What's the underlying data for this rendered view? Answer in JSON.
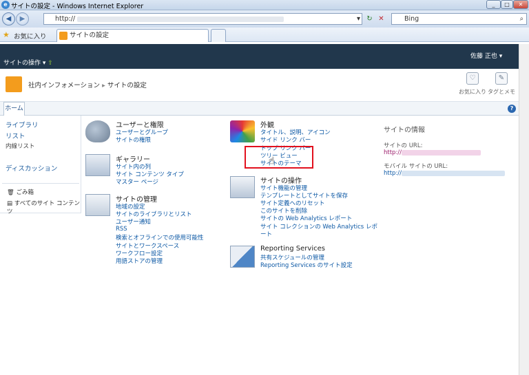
{
  "window": {
    "title": "サイトの設定 - Windows Internet Explorer"
  },
  "address": {
    "value": "http://",
    "search_engine": "Bing"
  },
  "favorites": {
    "label": "お気に入り",
    "tab": "サイトの設定"
  },
  "topnav": {
    "site_actions": "サイトの操作",
    "user": "佐藤 正也"
  },
  "header": {
    "site": "社内インフォメーション",
    "page": "サイトの設定",
    "favorite": "お気に入り",
    "tag": "タグとメモ"
  },
  "ribbon": {
    "home": "ホーム"
  },
  "leftnav": {
    "libraries": "ライブラリ",
    "lists": "リスト",
    "inner_list": "内線リスト",
    "discussions": "ディスカッション",
    "recycle": "ごみ箱",
    "all_content": "すべてのサイト コンテンツ"
  },
  "sections": {
    "users": {
      "title": "ユーザーと権限",
      "links": [
        "ユーザーとグループ",
        "サイトの権限"
      ]
    },
    "gallery": {
      "title": "ギャラリー",
      "links": [
        "サイト内の列",
        "サイト コンテンツ タイプ",
        "マスター ページ"
      ]
    },
    "admin": {
      "title": "サイトの管理",
      "links": [
        "地域の設定",
        "サイトのライブラリとリスト",
        "ユーザー通知",
        "RSS",
        "検索とオフラインでの使用可能性",
        "サイトとワークスペース",
        "ワークフロー設定",
        "用語ストアの管理"
      ]
    },
    "look": {
      "title": "外観",
      "links": [
        "タイトル、説明、アイコン",
        "サイド リンク バー",
        "トップ リンク バー",
        "ツリー ビュー",
        "サイトのテーマ"
      ]
    },
    "actions": {
      "title": "サイトの操作",
      "links": [
        "サイト機能の管理",
        "テンプレートとしてサイトを保存",
        "サイト定義へのリセット",
        "このサイトを削除",
        "サイトの Web Analytics レポート",
        "サイト コレクションの Web Analytics レポ",
        "ート"
      ]
    },
    "reporting": {
      "title": "Reporting Services",
      "links": [
        "共有スケジュールの管理",
        "Reporting Services のサイト設定"
      ]
    }
  },
  "info": {
    "title": "サイトの情報",
    "url_label": "サイトの URL:",
    "mobile_label": "モバイル サイトの URL:",
    "url_prefix": "http://"
  },
  "colors": {
    "topnav": "#21374c",
    "link": "#0b57a4",
    "highlight": "#e2101d"
  }
}
